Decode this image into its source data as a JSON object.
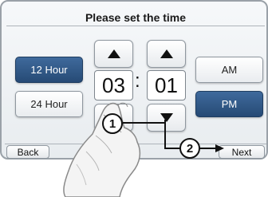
{
  "dialog": {
    "title": "Please set the time"
  },
  "format_options": {
    "twelve_hour": "12 Hour",
    "twenty_four_hour": "24 Hour",
    "selected": "12 Hour"
  },
  "time": {
    "hours": "03",
    "separator": ":",
    "minutes": "01"
  },
  "period_options": {
    "am": "AM",
    "pm": "PM",
    "selected": "PM"
  },
  "navigation": {
    "back": "Back",
    "next": "Next"
  },
  "callouts": {
    "first": "1",
    "second": "2"
  },
  "colors": {
    "selected_button": "#2f578a",
    "panel_border": "#9aa1a8"
  }
}
